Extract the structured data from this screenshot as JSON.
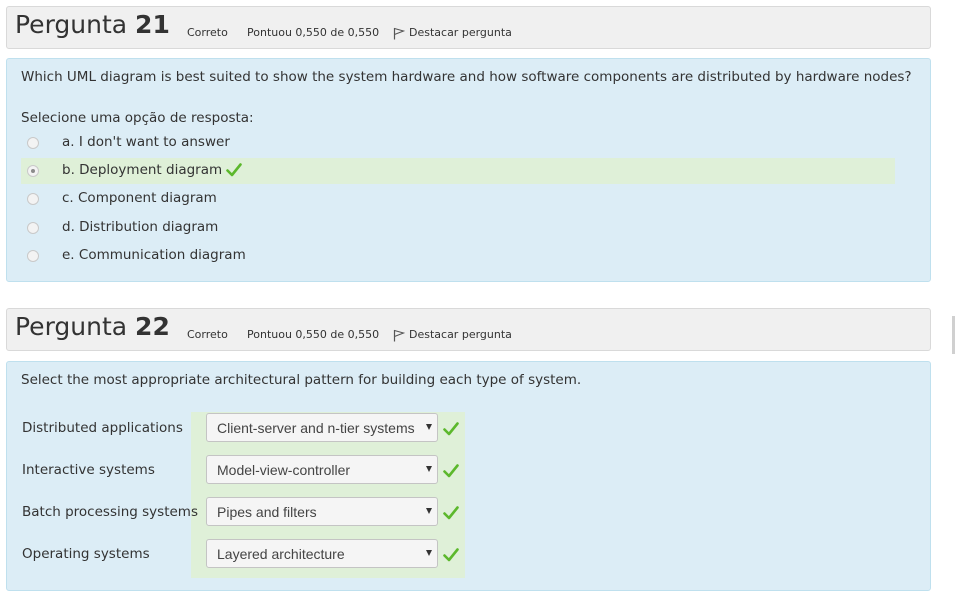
{
  "questions": [
    {
      "title_word": "Pergunta",
      "number": "21",
      "status": "Correto",
      "score": "Pontuou 0,550 de 0,550",
      "flag_label": "Destacar pergunta",
      "question_text": "Which UML diagram is best suited to show the system hardware and how software components are distributed by hardware nodes?",
      "prompt": "Selecione uma opção de resposta:",
      "options": [
        {
          "label": "a. I don't want to answer",
          "selected": false,
          "correct": false
        },
        {
          "label": "b. Deployment diagram",
          "selected": true,
          "correct": true
        },
        {
          "label": "c. Component diagram",
          "selected": false,
          "correct": false
        },
        {
          "label": "d. Distribution diagram",
          "selected": false,
          "correct": false
        },
        {
          "label": "e. Communication diagram",
          "selected": false,
          "correct": false
        }
      ]
    },
    {
      "title_word": "Pergunta",
      "number": "22",
      "status": "Correto",
      "score": "Pontuou 0,550 de 0,550",
      "flag_label": "Destacar pergunta",
      "question_text": "Select the most appropriate architectural pattern for building each type of system.",
      "matches": [
        {
          "label": "Distributed applications",
          "value": "Client-server and n-tier systems",
          "correct": true
        },
        {
          "label": "Interactive systems",
          "value": "Model-view-controller",
          "correct": true
        },
        {
          "label": "Batch processing systems",
          "value": "Pipes and filters",
          "correct": true
        },
        {
          "label": "Operating systems",
          "value": "Layered architecture",
          "correct": true
        }
      ]
    }
  ],
  "colors": {
    "header_bg": "#f0f0f0",
    "body_bg": "#dcedf6",
    "correct_bg": "#dff0d8",
    "check": "#5cb82c"
  },
  "icons": {
    "flag": "flag-icon",
    "check": "check-icon",
    "caret": "caret-down-icon",
    "radio": "radio-icon"
  }
}
